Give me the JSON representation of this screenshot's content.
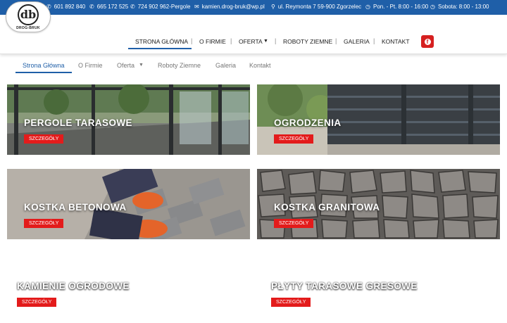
{
  "logo": {
    "initials": "db",
    "name": "DROG-BRUK"
  },
  "topbar": {
    "phone1": "601 892 840",
    "phone2": "665 172 525",
    "phone3": "724 902 962-Pergole",
    "email": "kamien.drog-bruk@wp.pl",
    "address": "ul. Reymonta 7 59-900 Zgorzelec",
    "hours_weekday": "Pon. - Pt. 8:00 - 16:00",
    "hours_saturday": "Sobota: 8:00 - 13:00"
  },
  "main_nav": {
    "items": [
      "STRONA GŁÓWNA",
      "O FIRMIE",
      "OFERTA",
      "ROBOTY ZIEMNE",
      "GALERIA",
      "KONTAKT"
    ],
    "active": "STRONA GŁÓWNA",
    "facebook": "f"
  },
  "sub_nav": {
    "items": [
      "Strona Główna",
      "O Firmie",
      "Oferta",
      "Roboty Ziemne",
      "Galeria",
      "Kontakt"
    ],
    "active": "Strona Główna"
  },
  "cards": [
    {
      "title": "PERGOLE TARASOWE",
      "button": "SZCZEGÓŁY"
    },
    {
      "title": "OGRODZENIA",
      "button": "SZCZEGÓŁY"
    },
    {
      "title": "KOSTKA BETONOWA",
      "button": "SZCZEGÓŁY"
    },
    {
      "title": "KOSTKA GRANITOWA",
      "button": "SZCZEGÓŁY"
    },
    {
      "title": "KAMIENIE OGRODOWE",
      "button": "SZCZEGÓŁY"
    },
    {
      "title": "PŁYTY TARASOWE GRESOWE",
      "button": "SZCZEGÓŁY"
    }
  ],
  "colors": {
    "brand_blue": "#1f5fa8",
    "accent_red": "#e31b1b"
  }
}
